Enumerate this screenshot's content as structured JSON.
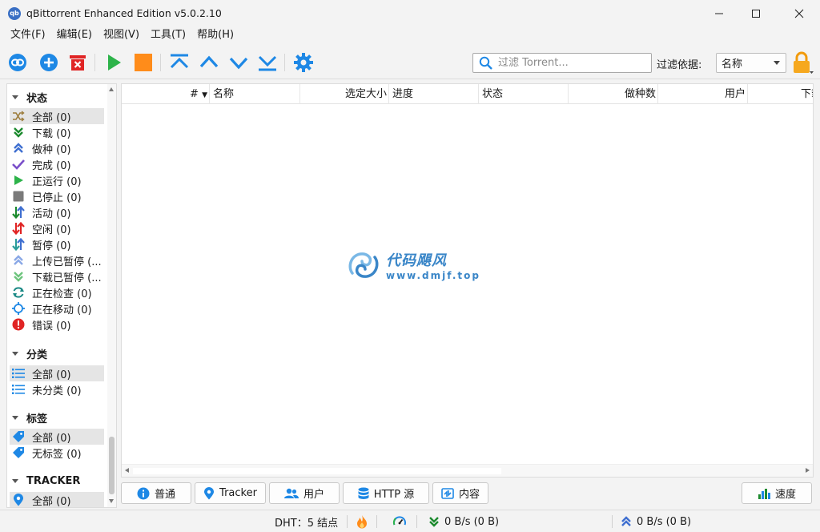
{
  "window": {
    "title": "qBittorrent Enhanced Edition v5.0.2.10",
    "icon_text": "qb"
  },
  "menu": [
    "文件(F)",
    "编辑(E)",
    "视图(V)",
    "工具(T)",
    "帮助(H)"
  ],
  "toolbar": {
    "search_placeholder": "过滤 Torrent...",
    "filter_label": "过滤依据:",
    "filter_value": "名称"
  },
  "sidebar": {
    "status": {
      "header": "状态",
      "items": [
        {
          "label": "全部 (0)",
          "icon": "shuffle-icon"
        },
        {
          "label": "下载 (0)",
          "icon": "double-chevron-down-icon"
        },
        {
          "label": "做种 (0)",
          "icon": "double-chevron-up-icon"
        },
        {
          "label": "完成 (0)",
          "icon": "checkmark-icon"
        },
        {
          "label": "正运行 (0)",
          "icon": "play-icon"
        },
        {
          "label": "已停止 (0)",
          "icon": "stop-square-icon"
        },
        {
          "label": "活动 (0)",
          "icon": "up-down-arrows-icon"
        },
        {
          "label": "空闲 (0)",
          "icon": "up-down-arrows-red-icon"
        },
        {
          "label": "暂停 (0)",
          "icon": "up-down-arrows-blue-icon"
        },
        {
          "label": "上传已暂停 (...",
          "icon": "upload-paused-icon"
        },
        {
          "label": "下载已暂停 (...",
          "icon": "download-paused-icon"
        },
        {
          "label": "正在检查 (0)",
          "icon": "refresh-icon"
        },
        {
          "label": "正在移动 (0)",
          "icon": "crosshair-icon"
        },
        {
          "label": "错误 (0)",
          "icon": "error-icon"
        }
      ]
    },
    "categories": {
      "header": "分类",
      "items": [
        {
          "label": "全部 (0)",
          "icon": "list-icon"
        },
        {
          "label": "未分类 (0)",
          "icon": "list-icon"
        }
      ]
    },
    "tags": {
      "header": "标签",
      "items": [
        {
          "label": "全部 (0)",
          "icon": "tag-icon"
        },
        {
          "label": "无标签 (0)",
          "icon": "tag-icon"
        }
      ]
    },
    "trackers": {
      "header": "TRACKER",
      "items": [
        {
          "label": "全部 (0)",
          "icon": "location-pin-icon"
        }
      ]
    }
  },
  "table": {
    "columns": [
      "#",
      "名称",
      "选定大小",
      "进度",
      "状态",
      "做种数",
      "用户",
      "下载"
    ]
  },
  "watermark": {
    "title": "代码飓风",
    "url": "www.dmjf.top"
  },
  "tabs": {
    "general": "普通",
    "trackers": "Tracker",
    "peers": "用户",
    "http": "HTTP 源",
    "content": "内容",
    "speed": "速度"
  },
  "status": {
    "dht": "DHT：5 结点",
    "download_speed": "0 B/s (0 B)",
    "upload_speed": "0 B/s (0 B)"
  },
  "colors": {
    "accent_blue": "#1e88e5",
    "green": "#2db34a",
    "orange": "#ff8c1a",
    "red": "#e02424"
  }
}
